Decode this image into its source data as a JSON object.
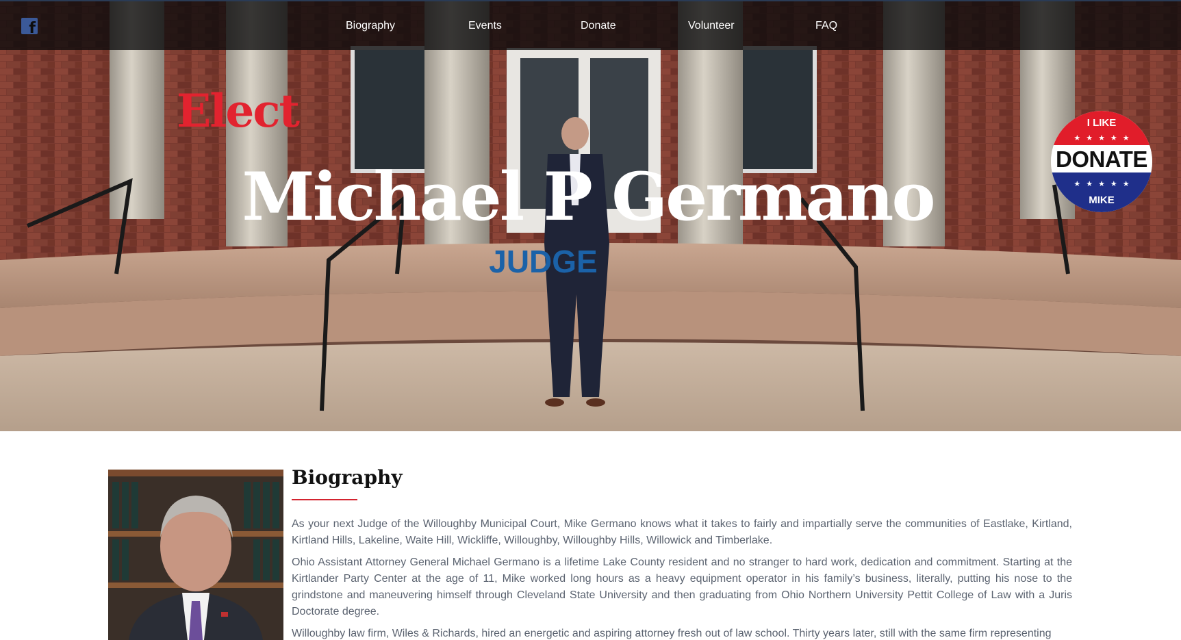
{
  "nav": {
    "facebook_icon": "facebook-icon",
    "items": [
      {
        "label": "Biography"
      },
      {
        "label": "Events"
      },
      {
        "label": "Donate"
      },
      {
        "label": "Volunteer"
      },
      {
        "label": "FAQ"
      }
    ]
  },
  "hero": {
    "elect": "Elect",
    "name": "Michael P Germano",
    "office": "JUDGE"
  },
  "donate_badge": {
    "top_text": "I LIKE",
    "stars": "★★★★★",
    "main_text": "DONATE",
    "bottom_text": "MIKE"
  },
  "biography": {
    "title": "Biography",
    "paragraphs": [
      "As your next Judge of the Willoughby Municipal Court, Mike Germano knows what it takes to fairly and impartially serve the communities of Eastlake, Kirtland, Kirtland Hills, Lakeline, Waite Hill, Wickliffe, Willoughby, Willoughby Hills, Willowick and Timberlake.",
      "Ohio Assistant Attorney General Michael Germano is a lifetime Lake County resident and no stranger to hard work, dedication and commitment. Starting at the Kirtlander Party Center at the age of 11, Mike worked long hours as a heavy equipment operator in his family’s business, literally, putting his nose to the grindstone and maneuvering himself through Cleveland State University and then graduating from Ohio Northern University Pettit College of Law with a Juris Doctorate degree.",
      "Willoughby law firm, Wiles & Richards, hired an energetic and aspiring attorney fresh out of law school. Thirty years later, still with the same firm representing"
    ]
  },
  "colors": {
    "accent_red": "#e2232f",
    "judge_blue": "#1b62a8",
    "nav_bg": "#0a0a0c",
    "body_text": "#5b6370"
  }
}
